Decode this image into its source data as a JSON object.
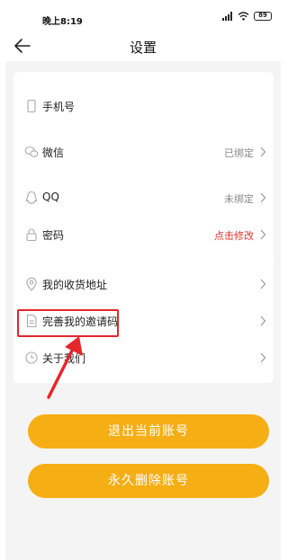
{
  "status_bar": {
    "time": "晚上8:19",
    "battery": "89"
  },
  "nav": {
    "title": "设置"
  },
  "account_items": [
    {
      "label": "手机号",
      "value": ""
    },
    {
      "label": "微信",
      "value": "已绑定"
    },
    {
      "label": "QQ",
      "value": "未绑定"
    },
    {
      "label": "密码",
      "value": "点击修改"
    }
  ],
  "other_items": [
    {
      "label": "我的收货地址"
    },
    {
      "label": "完善我的邀请码"
    },
    {
      "label": "关于我们"
    }
  ],
  "buttons": {
    "logout": "退出当前账号",
    "delete": "永久删除账号"
  },
  "colors": {
    "accent": "#f5ae14",
    "highlight": "#e5262a",
    "link_red": "#e0302a",
    "page_bg": "#f4f4f4"
  }
}
